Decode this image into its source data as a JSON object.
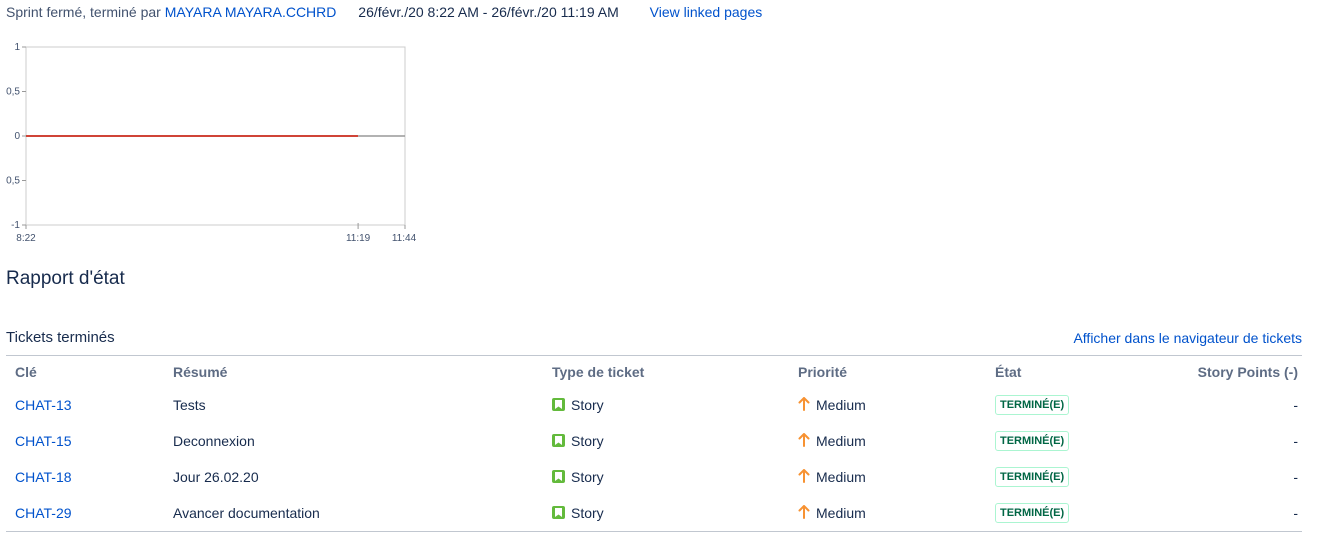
{
  "sprint": {
    "status_prefix": "Sprint fermé, terminé par ",
    "closed_by": "MAYARA MAYARA.CCHRD",
    "date_range": "26/févr./20 8:22 AM - 26/févr./20 11:19 AM",
    "linked_pages_label": "View linked pages"
  },
  "chart_data": {
    "type": "line",
    "x_ticks": [
      "8:22",
      "11:19",
      "11:44"
    ],
    "y_ticks": [
      "1",
      "0,5",
      "0",
      "0,5",
      "-1"
    ],
    "ylim": [
      -1,
      1
    ],
    "grid": false,
    "series": [
      {
        "x": [
          "8:22",
          "11:19"
        ],
        "values": [
          0,
          0
        ],
        "color": "#d04437"
      },
      {
        "x": [
          "11:19",
          "11:44"
        ],
        "values": [
          0,
          0
        ],
        "color": "#999999"
      }
    ]
  },
  "report": {
    "title": "Rapport d'état"
  },
  "completed": {
    "title": "Tickets terminés",
    "navigator_link": "Afficher dans le navigateur de tickets",
    "headers": {
      "key": "Clé",
      "summary": "Résumé",
      "type": "Type de ticket",
      "priority": "Priorité",
      "state": "État",
      "points": "Story Points (-)"
    },
    "rows": [
      {
        "key": "CHAT-13",
        "summary": "Tests",
        "type": "Story",
        "priority": "Medium",
        "state": "TERMINÉ(E)",
        "points": "-"
      },
      {
        "key": "CHAT-15",
        "summary": "Deconnexion",
        "type": "Story",
        "priority": "Medium",
        "state": "TERMINÉ(E)",
        "points": "-"
      },
      {
        "key": "CHAT-18",
        "summary": "Jour 26.02.20",
        "type": "Story",
        "priority": "Medium",
        "state": "TERMINÉ(E)",
        "points": "-"
      },
      {
        "key": "CHAT-29",
        "summary": "Avancer documentation",
        "type": "Story",
        "priority": "Medium",
        "state": "TERMINÉ(E)",
        "points": "-"
      }
    ]
  },
  "icons": {
    "story": "story-icon",
    "priority": "arrow-up-icon"
  },
  "colors": {
    "link": "#0052cc",
    "story": "#63ba3c",
    "priority_medium": "#f79232",
    "done": "#006644"
  }
}
